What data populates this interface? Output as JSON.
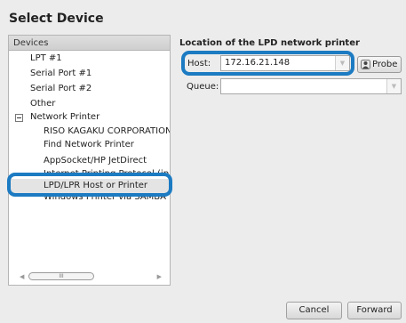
{
  "dialog": {
    "title": "Select Device"
  },
  "tree": {
    "header": "Devices",
    "items": [
      {
        "label": "LPT #1"
      },
      {
        "label": "Serial Port #1"
      },
      {
        "label": "Serial Port #2"
      },
      {
        "label": "Other"
      },
      {
        "label": "Network Printer"
      },
      {
        "label": "RISO KAGAKU CORPORATION"
      },
      {
        "label": "Find Network Printer"
      },
      {
        "label": "AppSocket/HP JetDirect"
      },
      {
        "label": "Internet Printing Protocol (ip"
      },
      {
        "label": "LPD/LPR Host or Printer"
      },
      {
        "label": "Windows Printer via SAMBA"
      }
    ],
    "scroll_thumb": "III"
  },
  "form": {
    "section_title": "Location of the LPD network printer",
    "host_label": "Host:",
    "host_value": "172.16.21.148",
    "probe_label": "Probe",
    "queue_label": "Queue:",
    "queue_value": ""
  },
  "buttons": {
    "cancel": "Cancel",
    "forward": "Forward"
  },
  "colors": {
    "highlight": "#1c7bc2"
  }
}
